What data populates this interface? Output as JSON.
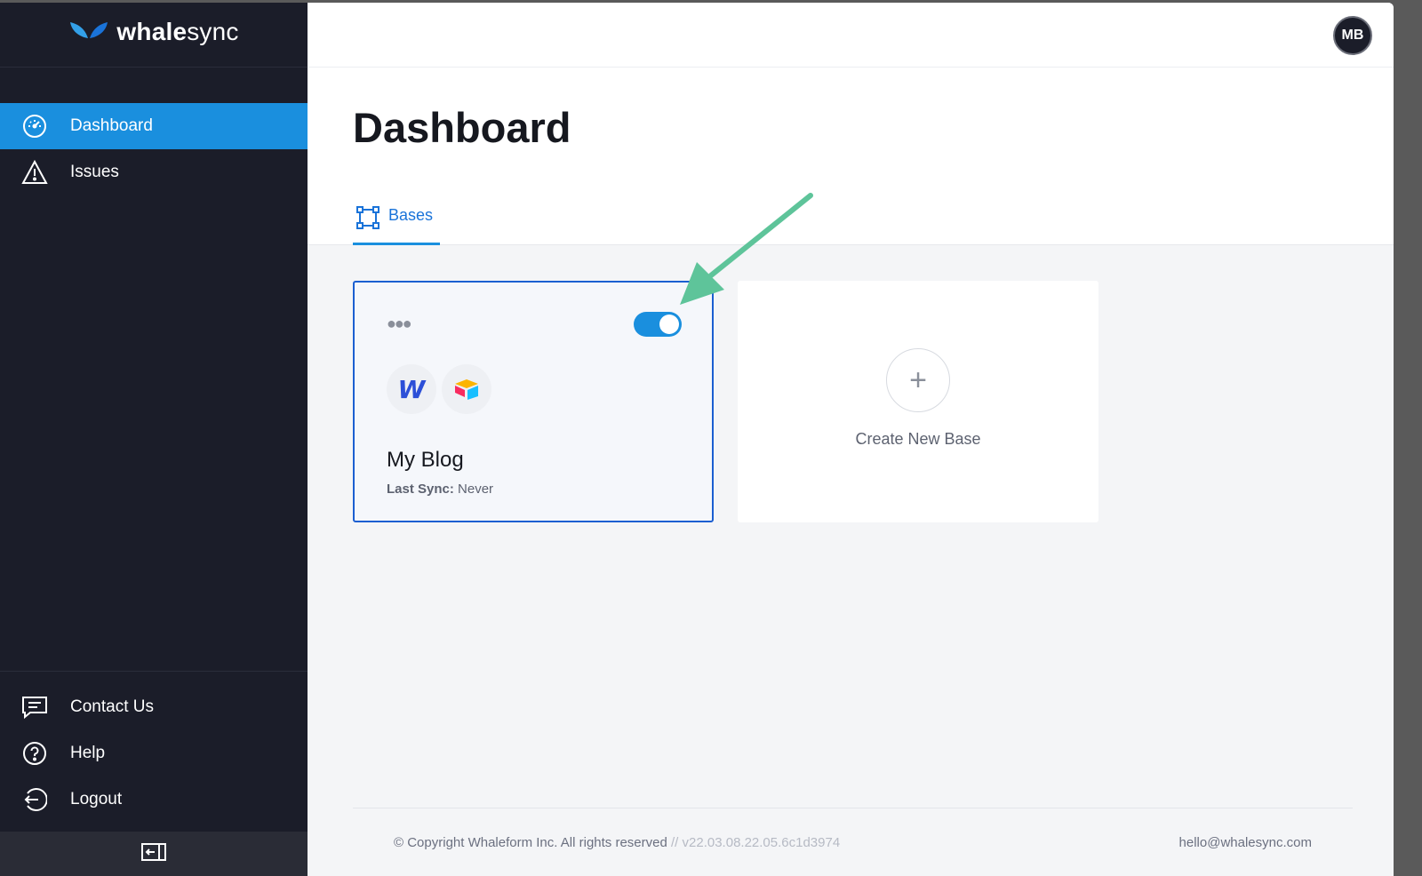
{
  "brand": {
    "name_bold": "whale",
    "name_light": "sync"
  },
  "sidebar": {
    "items": [
      {
        "label": "Dashboard",
        "icon": "dashboard-gauge-icon",
        "active": true
      },
      {
        "label": "Issues",
        "icon": "warning-triangle-icon",
        "active": false
      }
    ],
    "bottom_items": [
      {
        "label": "Contact Us",
        "icon": "chat-icon"
      },
      {
        "label": "Help",
        "icon": "question-circle-icon"
      },
      {
        "label": "Logout",
        "icon": "logout-icon"
      }
    ],
    "collapse_icon": "collapse-sidebar-icon"
  },
  "user": {
    "initials": "MB"
  },
  "page": {
    "title": "Dashboard",
    "tab": "Bases",
    "tab_icon": "bases-icon"
  },
  "cards": [
    {
      "title": "My Blog",
      "last_sync_label": "Last Sync:",
      "last_sync_value": "Never",
      "sync_enabled": true,
      "apps": [
        "W",
        "airtable-icon"
      ]
    }
  ],
  "create_card": {
    "label": "Create New Base",
    "icon": "+"
  },
  "footer": {
    "copyright": "© Copyright Whaleform Inc. All rights reserved",
    "version": "// v22.03.08.22.05.6c1d3974",
    "email": "hello@whalesync.com"
  },
  "colors": {
    "accent": "#1a8fde",
    "sidebar_bg": "#1b1d29",
    "card_border": "#1b5fd1",
    "annotation_arrow": "#5ec49a"
  }
}
